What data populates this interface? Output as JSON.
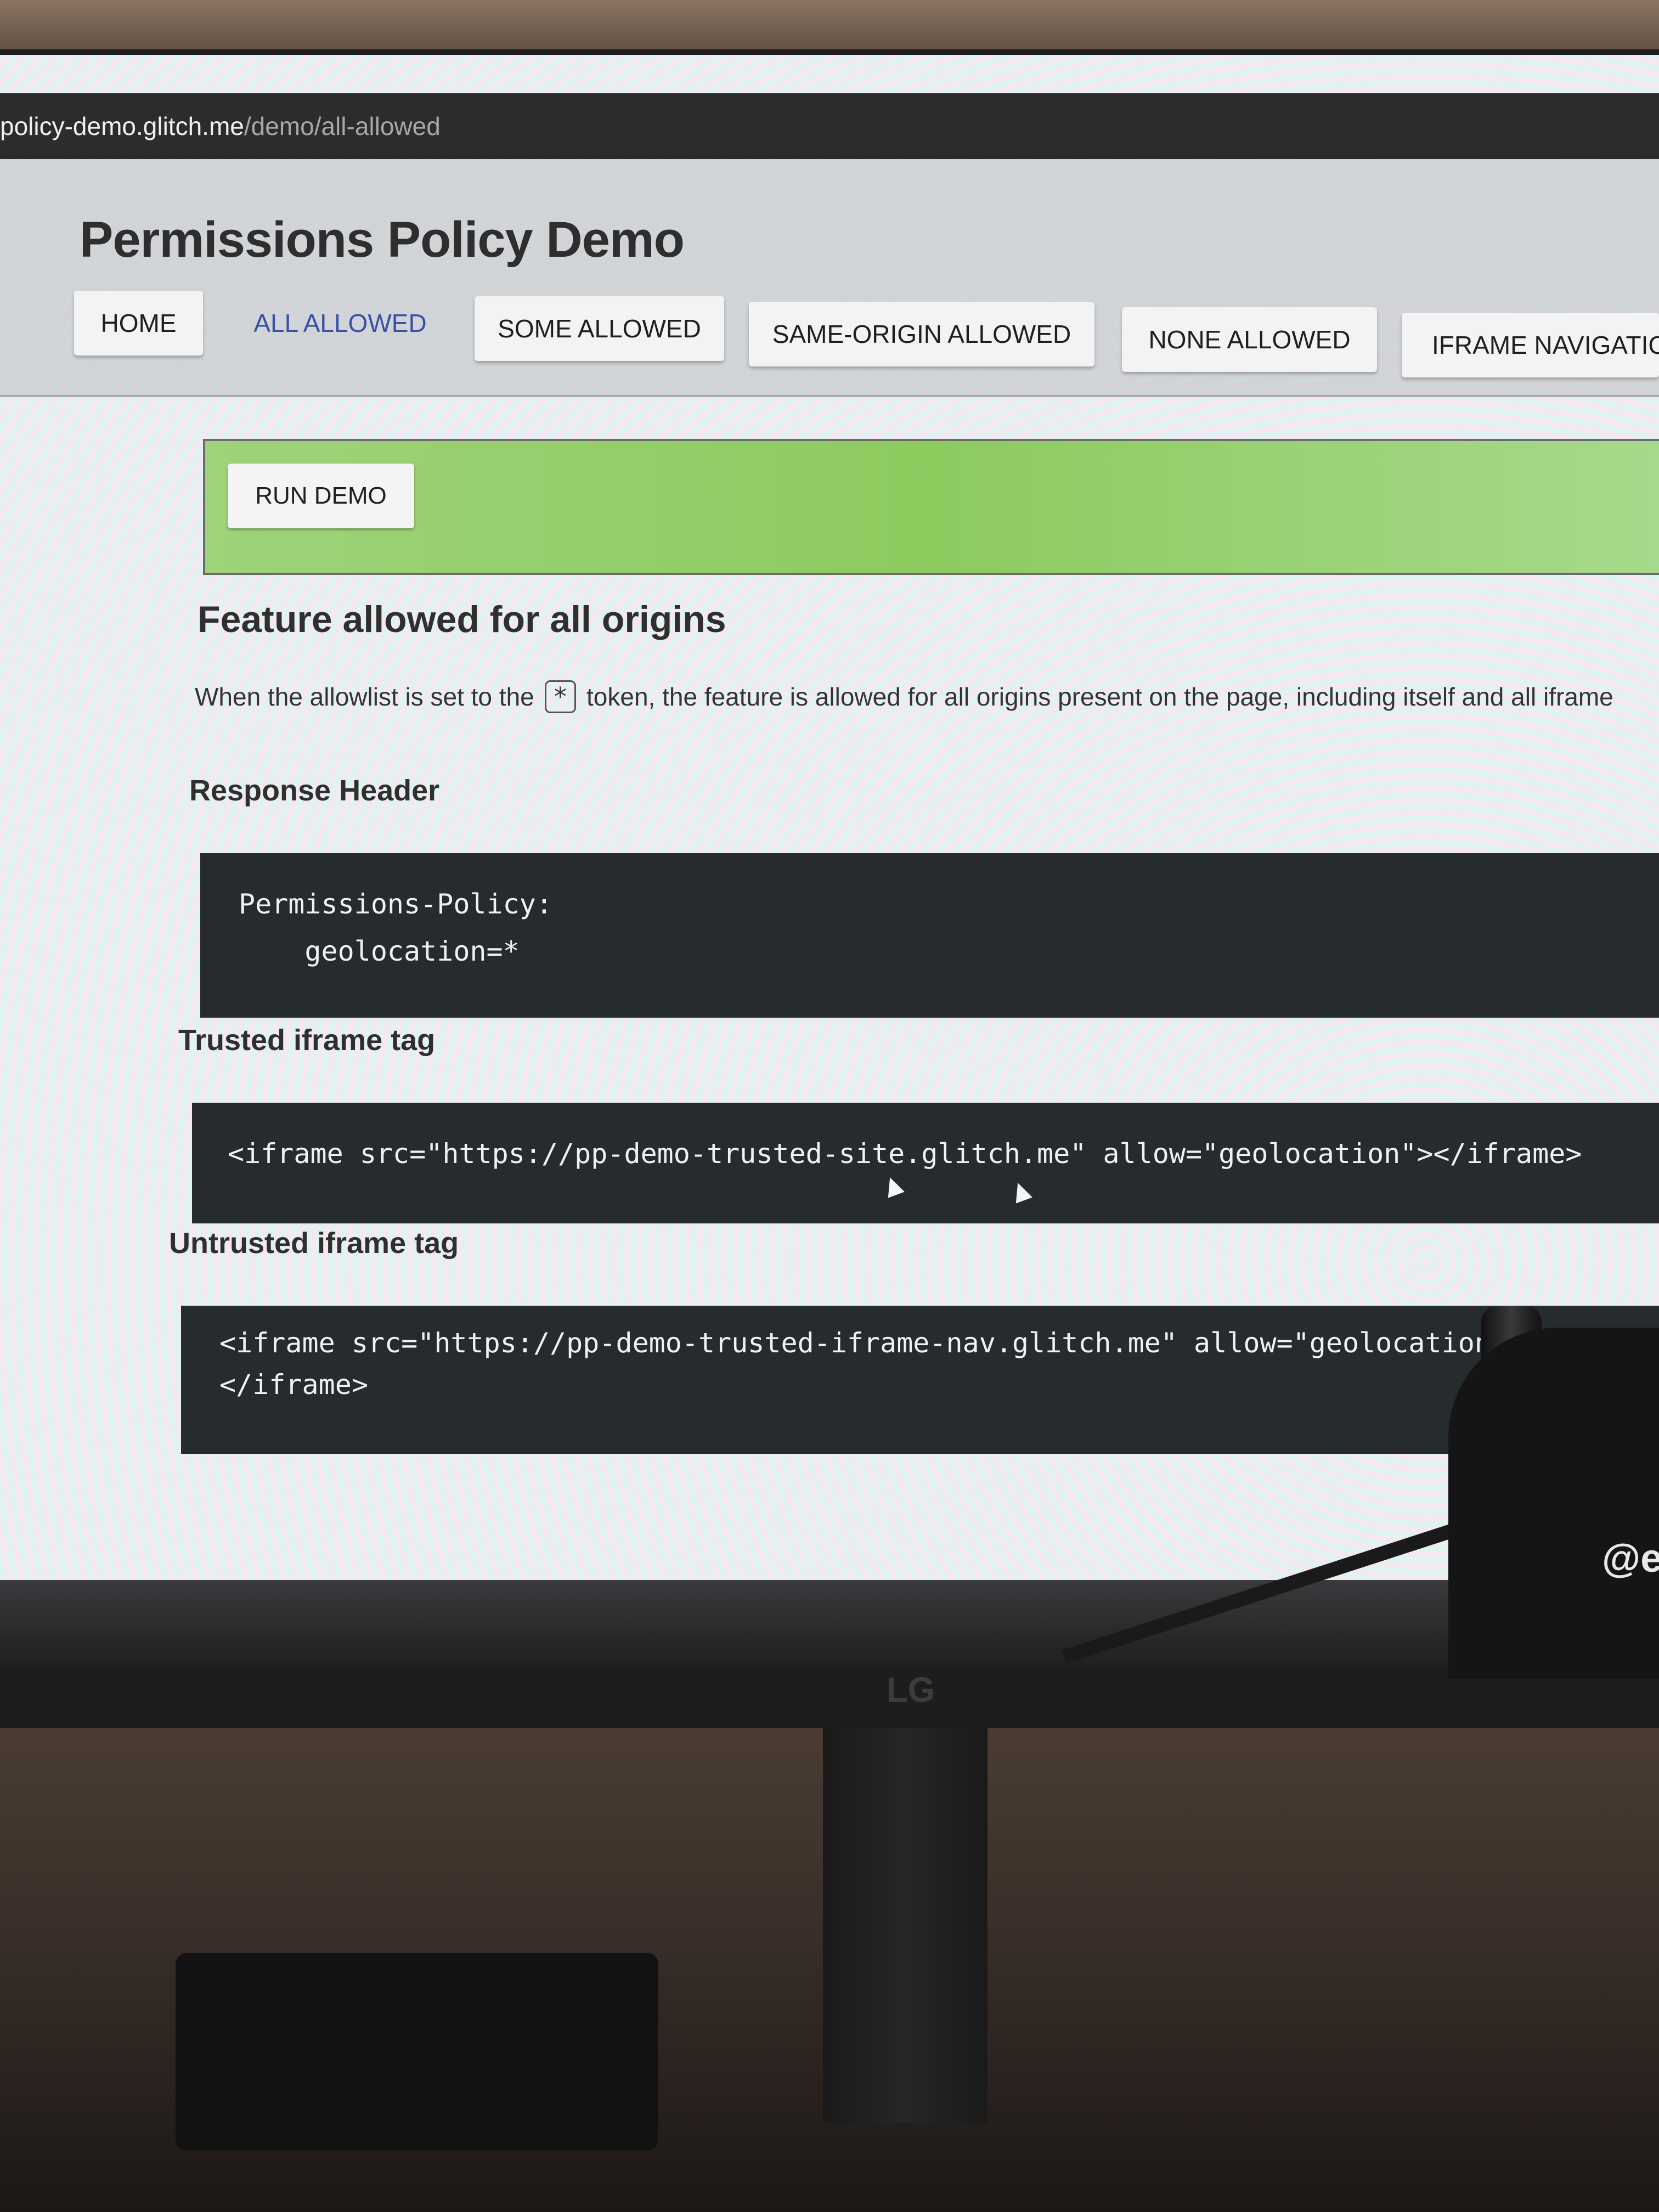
{
  "browser": {
    "url_host": "policy-demo.glitch.me",
    "url_path": "/demo/all-allowed"
  },
  "site": {
    "title": "Permissions Policy Demo",
    "nav": [
      {
        "label": "HOME"
      },
      {
        "label": "ALL ALLOWED"
      },
      {
        "label": "SOME ALLOWED"
      },
      {
        "label": "SAME-ORIGIN ALLOWED"
      },
      {
        "label": "NONE ALLOWED"
      },
      {
        "label": "IFRAME NAVIGATIC"
      }
    ]
  },
  "demo": {
    "run_label": "RUN DEMO",
    "section_title": "Feature allowed for all origins",
    "desc_before": "When the allowlist is set to the",
    "desc_token": "*",
    "desc_after": "token, the feature is allowed for all origins present on the page, including itself and all iframe",
    "response_header_label": "Response Header",
    "response_header_code": "Permissions-Policy:\n    geolocation=*",
    "trusted_label": "Trusted iframe tag",
    "trusted_code": "<iframe src=\"https://pp-demo-trusted-site.glitch.me\" allow=\"geolocation\"></iframe>",
    "untrusted_label": "Untrusted iframe tag",
    "untrusted_code": "<iframe src=\"https://pp-demo-trusted-iframe-nav.glitch.me\" allow=\"geolocation\"\n</iframe>"
  },
  "overlay": {
    "handle": "@e",
    "monitor_brand": "LG"
  },
  "colors": {
    "code_bg": "#262b2e",
    "demo_bar": "#8ccb5e",
    "active_nav_text": "#3a4fa8"
  }
}
